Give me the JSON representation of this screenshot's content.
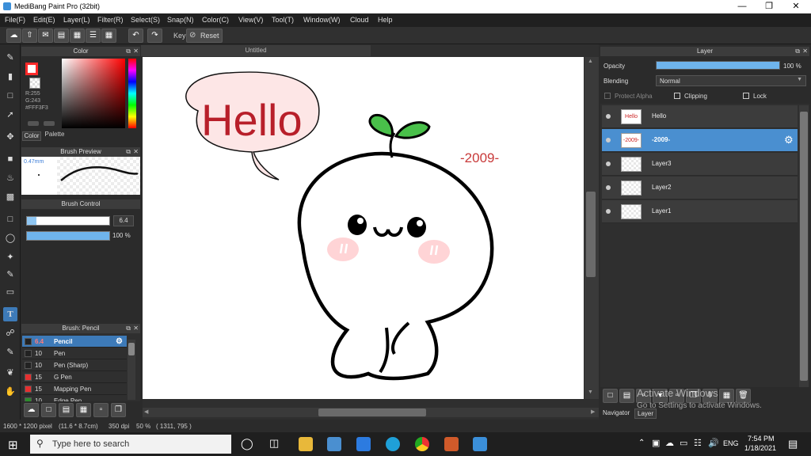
{
  "window": {
    "title": "MediBang Paint Pro (32bit)"
  },
  "menu": [
    "File(F)",
    "Edit(E)",
    "Layer(L)",
    "Filter(R)",
    "Select(S)",
    "Snap(N)",
    "Color(C)",
    "View(V)",
    "Tool(T)",
    "Window(W)",
    "Cloud",
    "Help"
  ],
  "toolbar": {
    "key_label": "Key",
    "reset_label": "Reset"
  },
  "color_panel": {
    "title": "Color",
    "r": "R:255",
    "g": "G:243",
    "hex": "#FFF3F3",
    "tab_color": "Color",
    "tab_palette": "Palette",
    "primary_color": "#ff2a2a",
    "secondary_color": "#ffffff"
  },
  "brush_preview": {
    "title": "Brush Preview",
    "size_label": "0.47mm"
  },
  "brush_control": {
    "title": "Brush Control",
    "size_value": "6.4",
    "opacity_value": "100 %"
  },
  "brush_list": {
    "title": "Brush: Pencil",
    "items": [
      {
        "size": "6.4",
        "name": "Pencil",
        "color": "#222",
        "selected": true
      },
      {
        "size": "10",
        "name": "Pen",
        "color": "#222"
      },
      {
        "size": "10",
        "name": "Pen (Sharp)",
        "color": "#222"
      },
      {
        "size": "15",
        "name": "G Pen",
        "color": "#e53030"
      },
      {
        "size": "15",
        "name": "Mapping Pen",
        "color": "#e53030"
      },
      {
        "size": "10",
        "name": "Edge Pen",
        "color": "#2c8c2c"
      }
    ]
  },
  "canvas": {
    "tab_title": "Untitled",
    "bubble_text": "Hello",
    "year_text": "-2009-"
  },
  "layer_panel": {
    "title": "Layer",
    "opacity_label": "Opacity",
    "opacity_value": "100 %",
    "opacity_fraction": 1.0,
    "blending_label": "Blending",
    "blending_value": "Normal",
    "protect_alpha": "Protect Alpha",
    "clipping": "Clipping",
    "lock": "Lock",
    "layers": [
      {
        "name": "Hello",
        "thumb": "Hello",
        "selected": false
      },
      {
        "name": "-2009-",
        "thumb": "-2009-",
        "selected": true
      },
      {
        "name": "Layer3",
        "thumb": "",
        "selected": false
      },
      {
        "name": "Layer2",
        "thumb": "",
        "selected": false
      },
      {
        "name": "Layer1",
        "thumb": "",
        "selected": false
      }
    ],
    "tab_navigator": "Navigator",
    "tab_layer": "Layer"
  },
  "watermark": {
    "line1": "Activate Windows",
    "line2": "Go to Settings to activate Windows."
  },
  "status": {
    "dimensions": "1600 * 1200 pixel",
    "physical": "(11.6 * 8.7cm)",
    "dpi": "350 dpi",
    "zoom": "50 %",
    "coords": "( 1311, 795 )"
  },
  "taskbar": {
    "search_placeholder": "Type here to search",
    "lang": "ENG",
    "time": "7:54 PM",
    "date": "1/18/2021"
  }
}
